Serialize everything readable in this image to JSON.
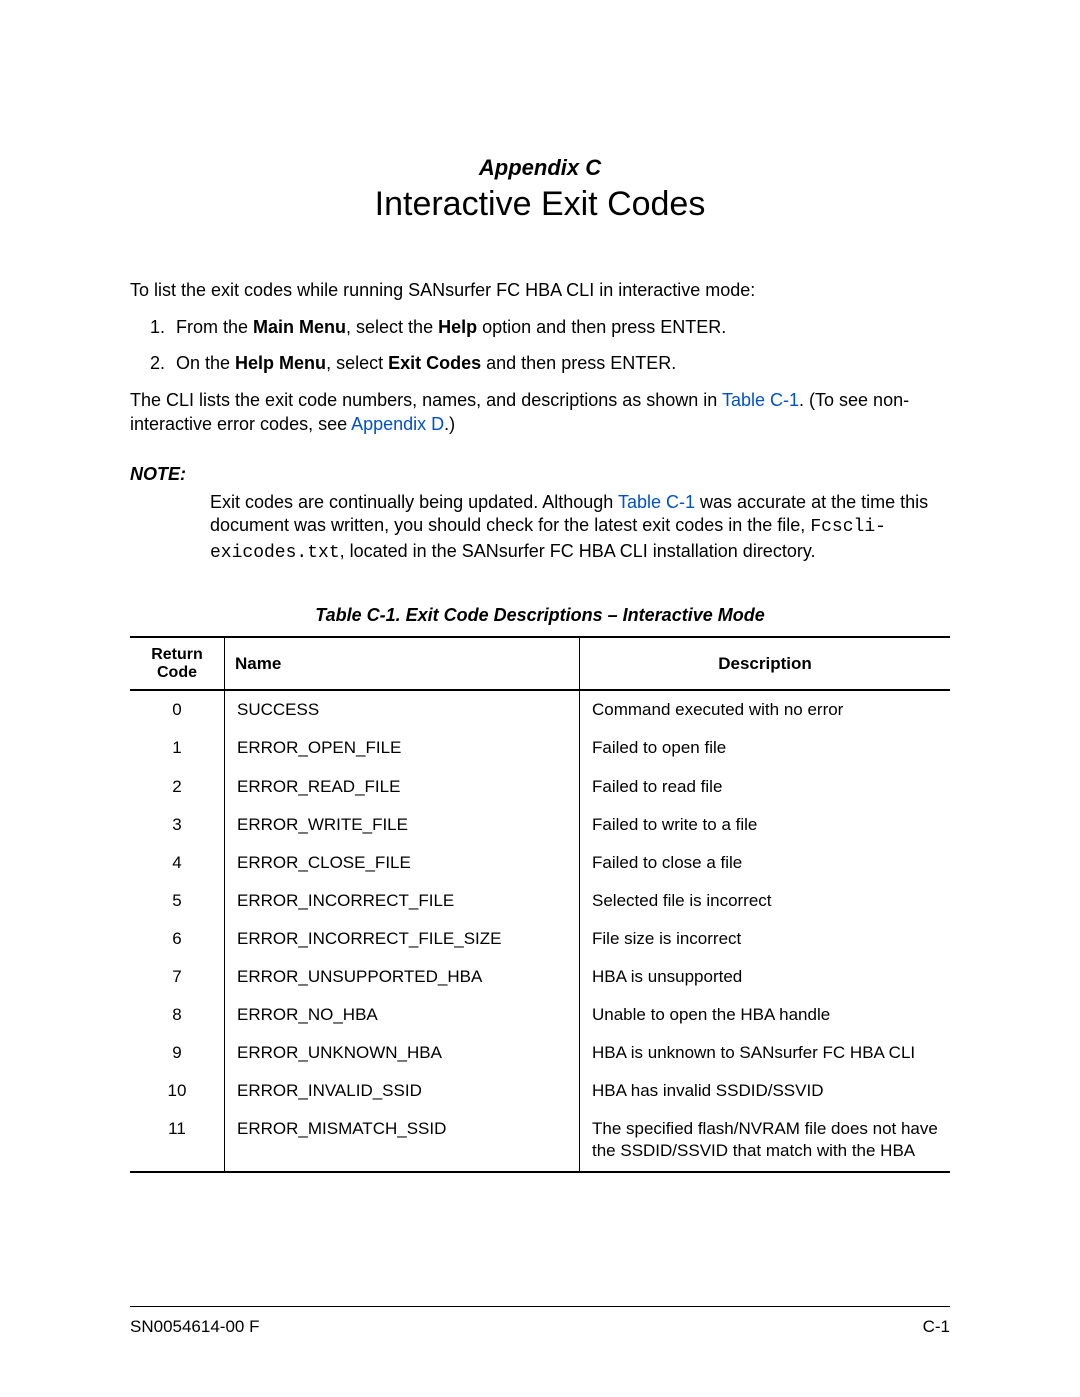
{
  "appendix_label": "Appendix C",
  "title": "Interactive Exit Codes",
  "intro": "To list the exit codes while running SANsurfer FC HBA CLI in interactive mode:",
  "step1_prefix": "From the ",
  "step1_b1": "Main Menu",
  "step1_mid": ", select the ",
  "step1_b2": "Help",
  "step1_suffix": " option and then press ENTER.",
  "step2_prefix": "On the ",
  "step2_b1": "Help Menu",
  "step2_mid": ", select ",
  "step2_b2": "Exit Codes",
  "step2_suffix": " and then press ENTER.",
  "para2_a": "The CLI lists the exit code numbers, names, and descriptions as shown in ",
  "para2_link1": "Table C-1",
  "para2_b": ". (To see non-interactive error codes, see ",
  "para2_link2": "Appendix D",
  "para2_c": ".)",
  "note_heading": "NOTE:",
  "note_a": "Exit codes are continually being updated. Although ",
  "note_link": "Table C-1",
  "note_b": " was accurate at the time this document was written, you should check for the latest exit codes in the file, ",
  "note_mono": "Fcscli-exicodes.txt",
  "note_c": ", located in the SANsurfer FC HBA CLI installation directory.",
  "table_caption": "Table C-1. Exit Code Descriptions – Interactive Mode",
  "th_code_l1": "Return",
  "th_code_l2": "Code",
  "th_name": "Name",
  "th_desc": "Description",
  "rows": [
    {
      "code": "0",
      "name": "SUCCESS",
      "desc": "Command executed with no error"
    },
    {
      "code": "1",
      "name": "ERROR_OPEN_FILE",
      "desc": "Failed to open file"
    },
    {
      "code": "2",
      "name": "ERROR_READ_FILE",
      "desc": "Failed to read file"
    },
    {
      "code": "3",
      "name": "ERROR_WRITE_FILE",
      "desc": "Failed to write to a file"
    },
    {
      "code": "4",
      "name": "ERROR_CLOSE_FILE",
      "desc": "Failed to close a file"
    },
    {
      "code": "5",
      "name": "ERROR_INCORRECT_FILE",
      "desc": "Selected file is incorrect"
    },
    {
      "code": "6",
      "name": "ERROR_INCORRECT_FILE_SIZE",
      "desc": "File size is incorrect"
    },
    {
      "code": "7",
      "name": "ERROR_UNSUPPORTED_HBA",
      "desc": "HBA is unsupported"
    },
    {
      "code": "8",
      "name": "ERROR_NO_HBA",
      "desc": "Unable to open the HBA handle"
    },
    {
      "code": "9",
      "name": "ERROR_UNKNOWN_HBA",
      "desc": "HBA is unknown to SANsurfer FC HBA CLI"
    },
    {
      "code": "10",
      "name": "ERROR_INVALID_SSID",
      "desc": "HBA has invalid SSDID/SSVID"
    },
    {
      "code": "11",
      "name": "ERROR_MISMATCH_SSID",
      "desc": "The specified flash/NVRAM file does not have the SSDID/SSVID that match with the HBA"
    }
  ],
  "footer_left": "SN0054614-00  F",
  "footer_right": "C-1"
}
